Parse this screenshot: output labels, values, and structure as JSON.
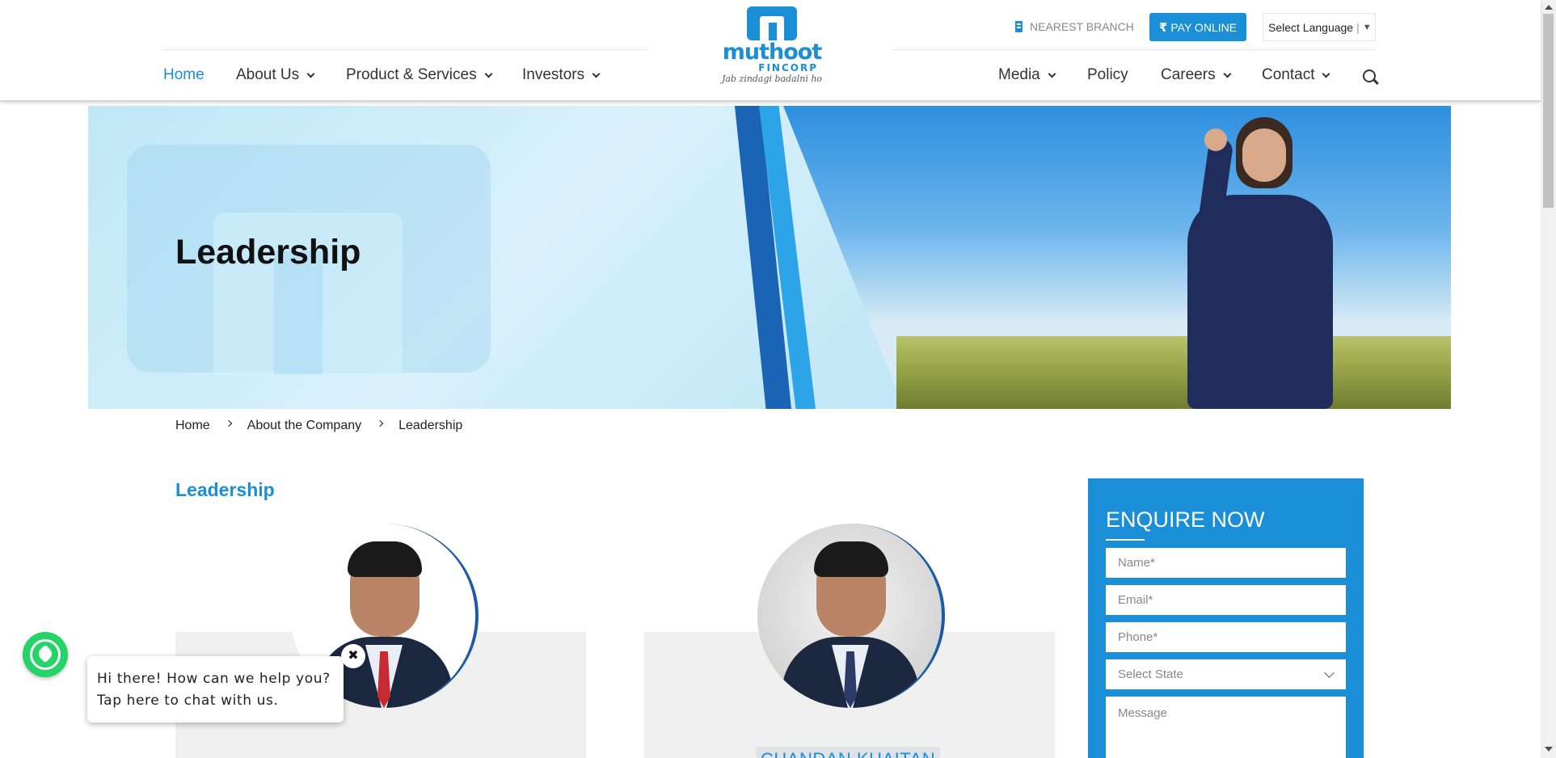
{
  "header": {
    "brand": {
      "name": "muthoot",
      "sub": "FINCORP",
      "tagline": "Jab zindagi badalni ho"
    },
    "nearest_branch": "NEAREST BRANCH",
    "pay_online": "PAY ONLINE",
    "pay_symbol": "₹",
    "language": {
      "selected": "Select Language",
      "separator": "|",
      "arrow": "▼"
    },
    "nav_left": [
      {
        "label": "Home",
        "active": true
      },
      {
        "label": "About Us",
        "dropdown": true
      },
      {
        "label": "Product & Services",
        "dropdown": true
      },
      {
        "label": "Investors",
        "dropdown": true
      }
    ],
    "nav_right": [
      {
        "label": "Media",
        "dropdown": true
      },
      {
        "label": "Policy"
      },
      {
        "label": "Careers",
        "dropdown": true
      },
      {
        "label": "Contact",
        "dropdown": true
      }
    ]
  },
  "banner": {
    "title": "Leadership"
  },
  "breadcrumb": [
    "Home",
    "About the Company",
    "Leadership"
  ],
  "section": {
    "title": "Leadership"
  },
  "leaders": [
    {
      "name": ""
    },
    {
      "name": "CHANDAN KHAITAN"
    }
  ],
  "enquire": {
    "title": "ENQUIRE NOW",
    "name_placeholder": "Name*",
    "email_placeholder": "Email*",
    "phone_placeholder": "Phone*",
    "state_placeholder": "Select State",
    "message_placeholder": "Message"
  },
  "chat": {
    "message": "Hi there! How can we help you? Tap here to chat with us.",
    "close": "✖"
  },
  "colors": {
    "brand_blue": "#1a8ed6",
    "dark_blue": "#1b5aa5",
    "whatsapp_green": "#25d366"
  },
  "icons": [
    "building-icon",
    "rupee-icon",
    "search-icon",
    "whatsapp-icon",
    "close-icon"
  ]
}
